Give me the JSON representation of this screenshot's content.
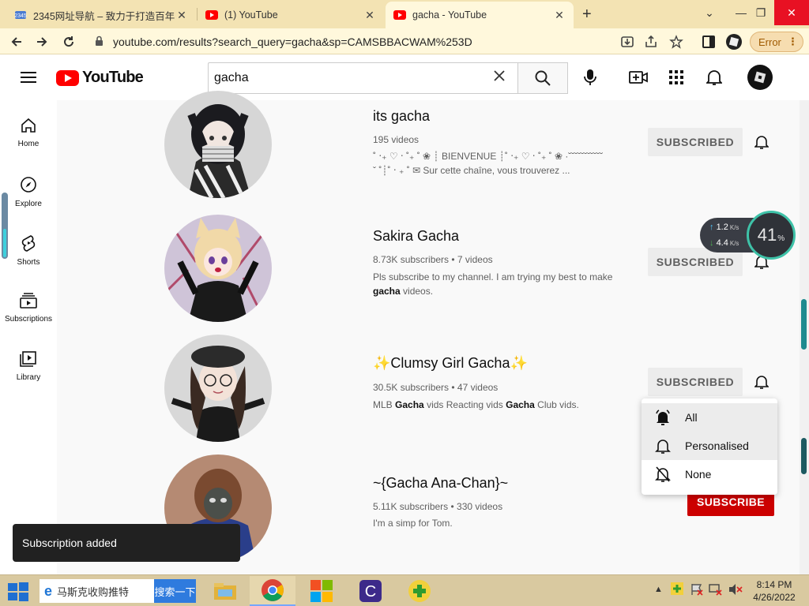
{
  "browser": {
    "tabs": [
      {
        "title": "2345网址导航 – 致力于打造百年",
        "favicon": "2345-icon"
      },
      {
        "title": "(1) YouTube",
        "favicon": "youtube-icon"
      },
      {
        "title": "gacha - YouTube",
        "favicon": "youtube-icon",
        "active": true
      }
    ],
    "url": "youtube.com/results?search_query=gacha&sp=CAMSBBACWAM%253D",
    "profile_status": "Error"
  },
  "youtube": {
    "logo_text": "YouTube",
    "search_query": "gacha",
    "sidebar": [
      {
        "label": "Home",
        "icon": "home-icon"
      },
      {
        "label": "Explore",
        "icon": "compass-icon"
      },
      {
        "label": "Shorts",
        "icon": "shorts-icon"
      },
      {
        "label": "Subscriptions",
        "icon": "subscriptions-icon"
      },
      {
        "label": "Library",
        "icon": "library-icon"
      }
    ],
    "results": [
      {
        "name": "its gacha",
        "meta": "195 videos",
        "desc_line1": "˚ ‧₊ ♡ ‧ ˚₊ ˚ ❀ ┊ BIENVENUE ┊˚ ‧₊ ♡ ‧ ˚₊ ˚ ❀ ·˘˘˘˘˘˘˘˘˘˘˘",
        "desc_line2": "ˇ ˚┊˚ ‧ ₊ ˚ ✉ Sur cette chaîne, vous trouverez ...",
        "button": "SUBSCRIBED"
      },
      {
        "name": "Sakira Gacha",
        "meta": "8.73K subscribers • 7 videos",
        "desc_a": "Pls subscribe to my channel. I am trying my best to make",
        "desc_b": "gacha",
        "desc_c": "videos.",
        "button": "SUBSCRIBED"
      },
      {
        "name_star": "✨",
        "name": "Clumsy Girl Gacha",
        "meta": "30.5K subscribers • 47 videos",
        "desc_a": "MLB",
        "desc_b": "Gacha",
        "desc_c": "vids Reacting vids",
        "desc_d": "Gacha",
        "desc_e": "Club vids.",
        "button": "SUBSCRIBED"
      },
      {
        "name": "~{Gacha Ana-Chan}~",
        "meta": "5.11K subscribers • 330 videos",
        "desc": "I'm a simp for Tom.",
        "button": "SUBSCRIBE"
      }
    ],
    "notification_menu": [
      "All",
      "Personalised",
      "None"
    ],
    "toast": "Subscription added"
  },
  "netspeed": {
    "up": "1.2",
    "down": "4.4",
    "unit": "K/s",
    "gauge": "41",
    "gauge_unit": "%"
  },
  "taskbar": {
    "search_text": "马斯克收购推特",
    "search_button": "搜索一下",
    "time": "8:14 PM",
    "date": "4/26/2022"
  },
  "colors": {
    "yt_red": "#ff0000",
    "subscribe_red": "#cc0000",
    "tab_bg": "#f3e3b3"
  }
}
